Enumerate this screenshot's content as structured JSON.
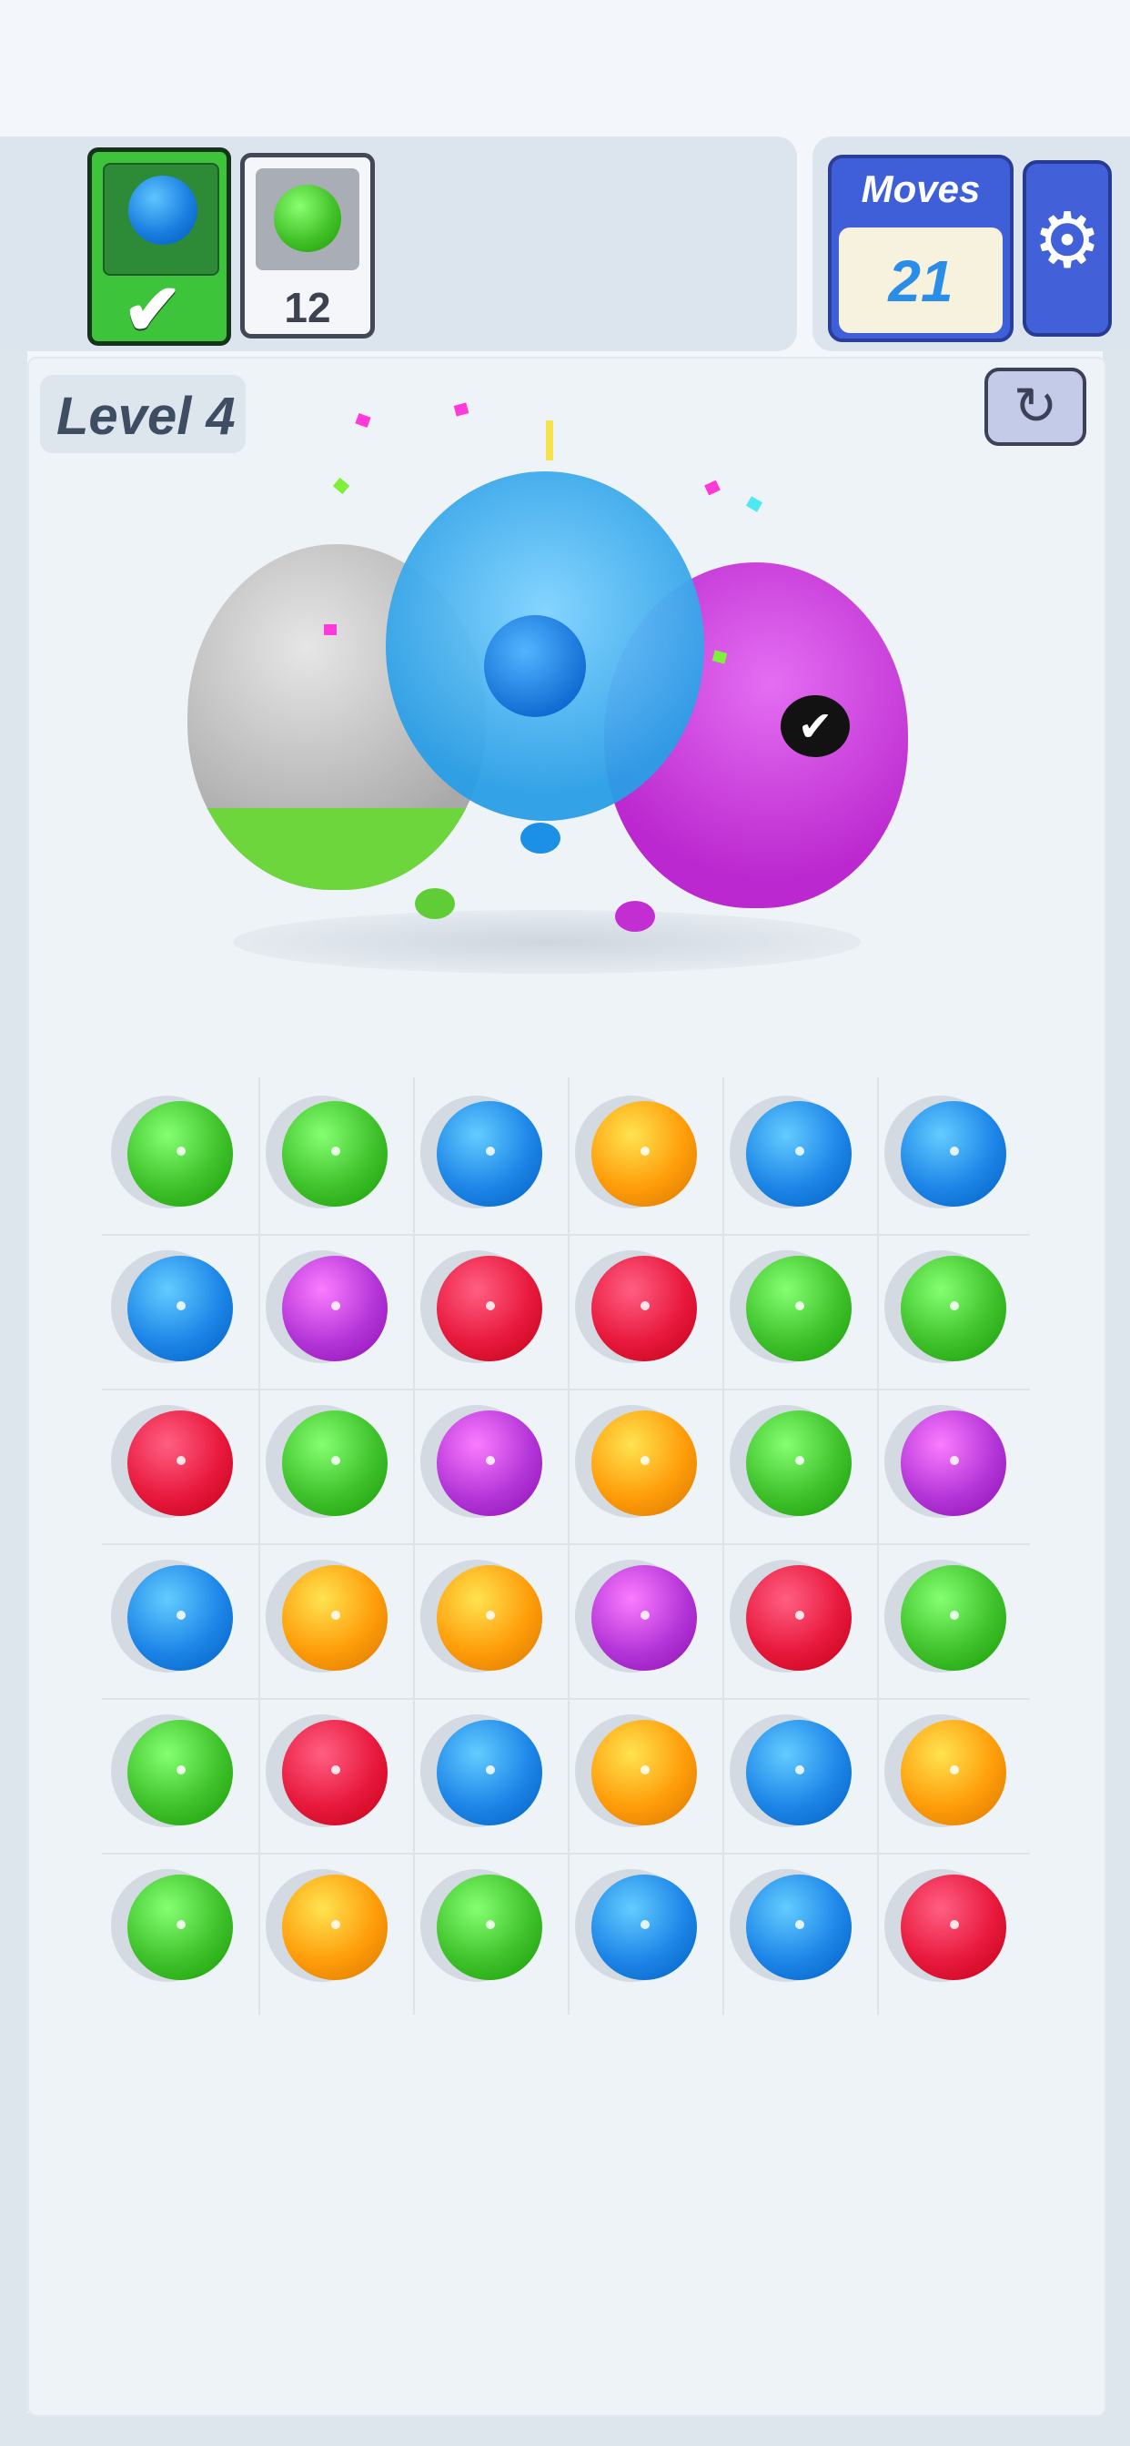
{
  "header": {
    "current_target": {
      "color": "#1a7fe0",
      "completed": true
    },
    "next_target": {
      "color": "#44c22a",
      "count": "12"
    },
    "moves": {
      "label": "Moves",
      "value": "21"
    }
  },
  "level": {
    "label": "Level 4"
  },
  "balloons": [
    {
      "name": "gray-balloon",
      "color": "#b4b4b4",
      "fill_color": "#6ed63d"
    },
    {
      "name": "blue-balloon",
      "color": "#2a9ee6",
      "state": "popping"
    },
    {
      "name": "purple-balloon",
      "color": "#cc3ee0",
      "badge": "check-icon"
    }
  ],
  "colors": {
    "green": "#3fc22b",
    "blue": "#1d86e8",
    "orange": "#ff9d0a",
    "red": "#e8193d",
    "purple": "#b536d8"
  },
  "board": [
    [
      "green",
      "green",
      "blue",
      "orange",
      "blue",
      "blue"
    ],
    [
      "blue",
      "purple",
      "red",
      "red",
      "green",
      "green"
    ],
    [
      "red",
      "green",
      "purple",
      "orange",
      "green",
      "purple"
    ],
    [
      "blue",
      "orange",
      "orange",
      "purple",
      "red",
      "green"
    ],
    [
      "green",
      "red",
      "blue",
      "orange",
      "blue",
      "orange"
    ],
    [
      "green",
      "orange",
      "green",
      "blue",
      "blue",
      "red"
    ]
  ],
  "icons": {
    "check": "✔",
    "gear": "⚙",
    "undo": "↻",
    "bubble_check": "✔"
  }
}
